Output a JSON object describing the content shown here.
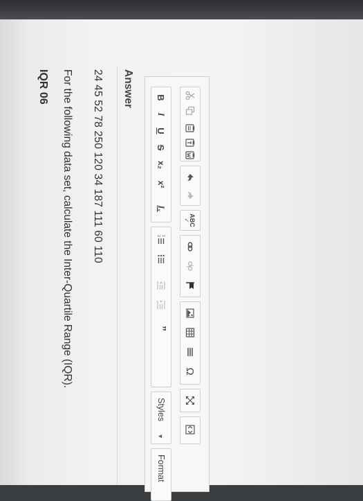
{
  "question": {
    "title": "IQR 06",
    "prompt": "For the following data set, calculate the Inter-Quartile Range (IQR).",
    "data_values": "24  45  52  78  250  120  34  187  111  60  110"
  },
  "answer": {
    "label": "Answer"
  },
  "toolbar": {
    "bold": "B",
    "italic": "I",
    "underline": "U",
    "strike": "S",
    "subscript": "x₂",
    "superscript": "x²",
    "remove_format": "Iₓ",
    "spellcheck": "ABC",
    "styles_label": "Styles",
    "format_label": "Format",
    "blockquote": "”",
    "omega": "Ω"
  }
}
